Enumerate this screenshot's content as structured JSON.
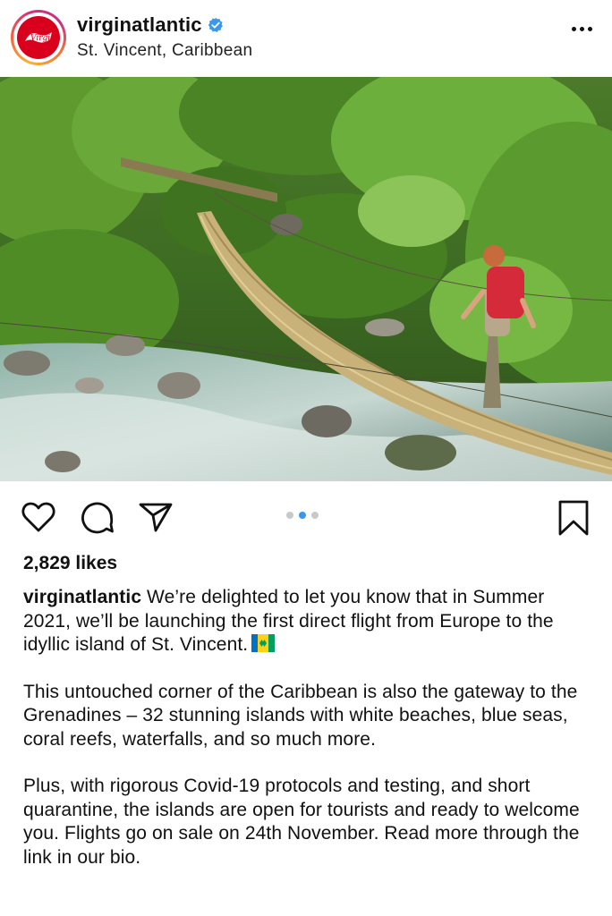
{
  "post": {
    "username": "virginatlantic",
    "location": "St. Vincent, Caribbean",
    "avatar_text": "Virgin",
    "likes": "2,829 likes",
    "carousel": {
      "count": 3,
      "active_index": 1
    },
    "caption": {
      "username": "virginatlantic",
      "paragraph1": "We’re delighted to let you know that in Summer 2021, we’ll be launching the first direct flight from Europe to the idyllic island of St. Vincent.",
      "paragraph2": "This untouched corner of the Caribbean is also the gateway to the Grenadines – 32 stunning islands with white beaches, blue seas, coral reefs, waterfalls, and so much more.",
      "paragraph3": "Plus, with rigorous Covid-19 protocols and testing, and short quarantine, the islands are open for tourists and ready to welcome you. Flights go on sale on 24th November. Read more through the link in our bio."
    }
  },
  "colors": {
    "verified": "#3897f0",
    "brand_red": "#d8001c",
    "dot_active": "#3897f0",
    "dot_inactive": "#c9c9c9"
  },
  "icons": [
    "verified-badge-icon",
    "more-options-icon",
    "heart-icon",
    "comment-icon",
    "share-icon",
    "bookmark-icon",
    "flag-icon"
  ]
}
